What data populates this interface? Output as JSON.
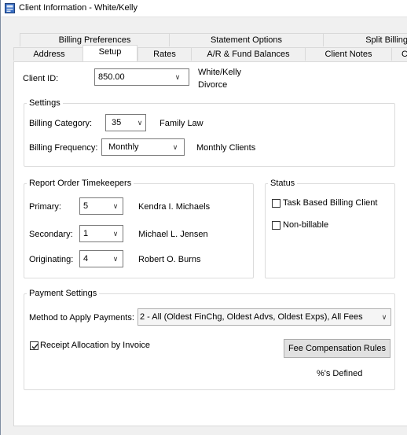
{
  "window": {
    "title": "Client Information - White/Kelly"
  },
  "tabs": {
    "row_back": [
      {
        "label": "Billing Preferences"
      },
      {
        "label": "Statement Options"
      },
      {
        "label": "Split Billing"
      }
    ],
    "row_front": [
      {
        "label": "Address"
      },
      {
        "label": "Setup",
        "active": true
      },
      {
        "label": "Rates"
      },
      {
        "label": "A/R & Fund Balances"
      },
      {
        "label": "Client Notes"
      },
      {
        "label": "C"
      }
    ]
  },
  "client": {
    "id_label": "Client ID:",
    "id_value": "850.00",
    "name": "White/Kelly",
    "description": "Divorce"
  },
  "settings": {
    "title": "Settings",
    "billing_category_label": "Billing Category:",
    "billing_category_value": "35",
    "billing_category_desc": "Family Law",
    "billing_frequency_label": "Billing Frequency:",
    "billing_frequency_value": "Monthly",
    "billing_frequency_desc": "Monthly Clients"
  },
  "timekeepers": {
    "title": "Report Order Timekeepers",
    "primary_label": "Primary:",
    "primary_value": "5",
    "primary_name": "Kendra I. Michaels",
    "secondary_label": "Secondary:",
    "secondary_value": "1",
    "secondary_name": "Michael L. Jensen",
    "originating_label": "Originating:",
    "originating_value": "4",
    "originating_name": "Robert O. Burns"
  },
  "status": {
    "title": "Status",
    "task_based_label": "Task Based Billing Client",
    "task_based_checked": false,
    "non_billable_label": "Non-billable",
    "non_billable_checked": false
  },
  "payment": {
    "title": "Payment Settings",
    "method_label": "Method to Apply Payments:",
    "method_value": "2 - All (Oldest FinChg, Oldest Advs, Oldest Exps), All Fees",
    "receipt_label": "Receipt Allocation by Invoice",
    "receipt_checked": true,
    "fee_button_label": "Fee Compensation Rules",
    "fee_defined_text": "%'s Defined"
  },
  "icons": {
    "dropdown": "chevron-down-icon",
    "check": "checkmark-icon",
    "app": "client-info-app-icon"
  }
}
